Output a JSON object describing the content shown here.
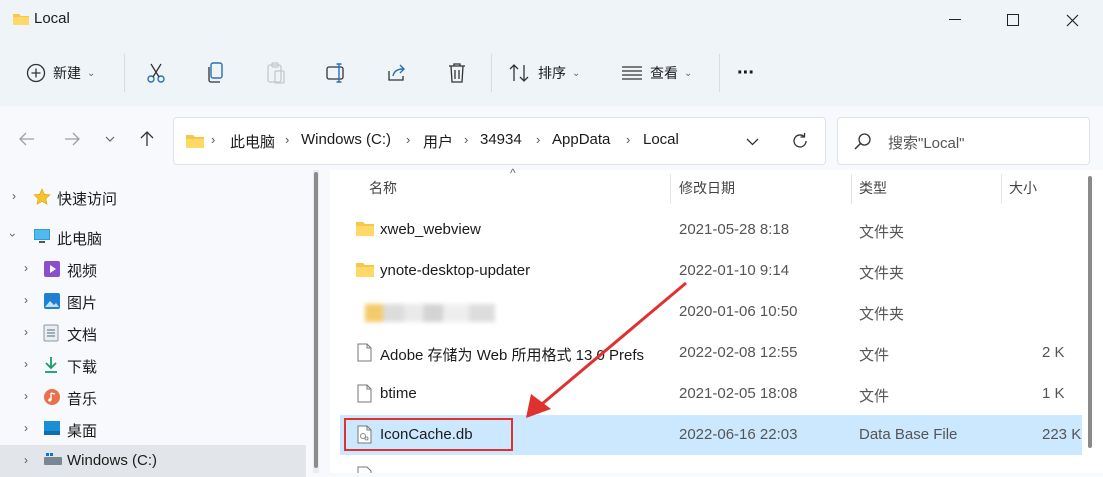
{
  "window": {
    "title": "Local"
  },
  "toolbar": {
    "new_label": "新建",
    "sort_label": "排序",
    "view_label": "查看",
    "more_label": "···"
  },
  "breadcrumb": [
    "此电脑",
    "Windows (C:)",
    "用户",
    "34934",
    "AppData",
    "Local"
  ],
  "search": {
    "placeholder": "搜索\"Local\""
  },
  "nav": {
    "items": [
      {
        "label": "快速访问",
        "icon": "star-icon"
      },
      {
        "label": "此电脑",
        "icon": "computer-icon"
      },
      {
        "label": "视频",
        "icon": "video-icon"
      },
      {
        "label": "图片",
        "icon": "picture-icon"
      },
      {
        "label": "文档",
        "icon": "document-icon"
      },
      {
        "label": "下载",
        "icon": "download-icon"
      },
      {
        "label": "音乐",
        "icon": "music-icon"
      },
      {
        "label": "桌面",
        "icon": "desktop-icon"
      },
      {
        "label": "Windows (C:)",
        "icon": "drive-icon"
      }
    ]
  },
  "columns": {
    "name": "名称",
    "date": "修改日期",
    "type": "类型",
    "size": "大小"
  },
  "files": [
    {
      "name": "xweb_webview",
      "date": "2021-05-28 8:18",
      "type": "文件夹",
      "size": "",
      "icon": "folder-icon"
    },
    {
      "name": "ynote-desktop-updater",
      "date": "2022-01-10 9:14",
      "type": "文件夹",
      "size": "",
      "icon": "folder-icon"
    },
    {
      "name": "",
      "date": "2020-01-06 10:50",
      "type": "文件夹",
      "size": "",
      "icon": "folder-icon"
    },
    {
      "name": "Adobe 存储为 Web 所用格式 13.0 Prefs",
      "date": "2022-02-08 12:55",
      "type": "文件",
      "size": "2 K",
      "icon": "file-icon"
    },
    {
      "name": "btime",
      "date": "2021-02-05 18:08",
      "type": "文件",
      "size": "1 K",
      "icon": "file-icon"
    },
    {
      "name": "IconCache.db",
      "date": "2022-06-16 22:03",
      "type": "Data Base File",
      "size": "223 K",
      "icon": "db-file-icon"
    }
  ],
  "colors": {
    "selection": "#cce8ff",
    "annotation": "#e03131",
    "folder": "#f5c84c"
  }
}
